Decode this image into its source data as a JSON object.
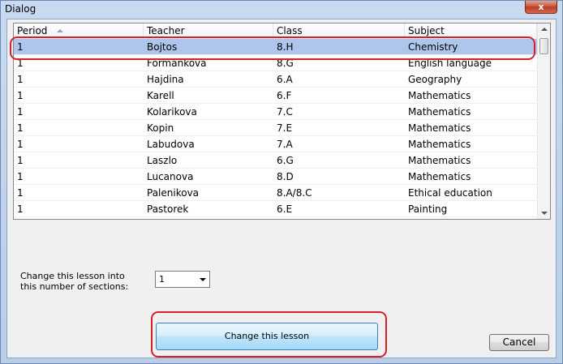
{
  "window": {
    "title": "Dialog",
    "close_symbol": "x"
  },
  "table": {
    "headers": [
      "Period",
      "Teacher",
      "Class",
      "Subject"
    ],
    "rows": [
      [
        "1",
        "Bojtos",
        "8.H",
        "Chemistry"
      ],
      [
        "1",
        "Formankova",
        "8.G",
        "English language"
      ],
      [
        "1",
        "Hajdina",
        "6.A",
        "Geography"
      ],
      [
        "1",
        "Karell",
        "6.F",
        "Mathematics"
      ],
      [
        "1",
        "Kolarikova",
        "7.C",
        "Mathematics"
      ],
      [
        "1",
        "Kopin",
        "7.E",
        "Mathematics"
      ],
      [
        "1",
        "Labudova",
        "7.A",
        "Mathematics"
      ],
      [
        "1",
        "Laszlo",
        "6.G",
        "Mathematics"
      ],
      [
        "1",
        "Lucanova",
        "8.D",
        "Mathematics"
      ],
      [
        "1",
        "Palenikova",
        "8.A/8.C",
        "Ethical education"
      ],
      [
        "1",
        "Pastorek",
        "6.E",
        "Painting"
      ]
    ],
    "selected_row": 0
  },
  "sections": {
    "label": "Change this lesson into this number of sections:",
    "value": "1"
  },
  "buttons": {
    "change": "Change this lesson",
    "cancel": "Cancel"
  },
  "colors": {
    "selection": "#aec6ec",
    "highlight": "#d9202a"
  }
}
